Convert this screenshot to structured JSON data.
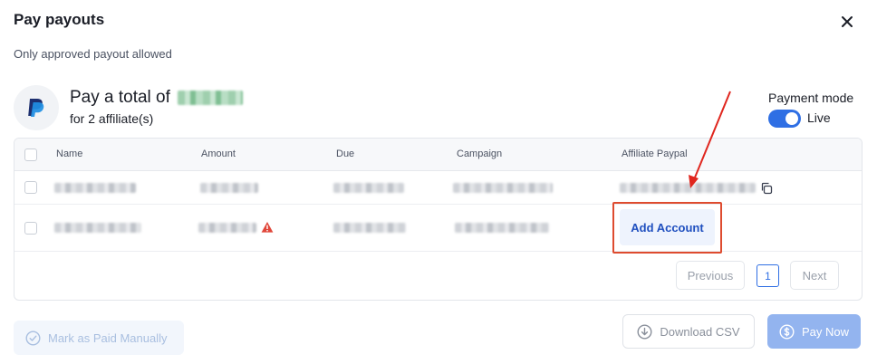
{
  "modal": {
    "title": "Pay payouts",
    "subtitle": "Only approved payout allowed"
  },
  "summary": {
    "total_prefix": "Pay a total of",
    "affiliate_count": "for 2 affiliate(s)"
  },
  "payment_mode": {
    "label": "Payment mode",
    "value": "Live",
    "enabled": true
  },
  "table": {
    "columns": [
      "Name",
      "Amount",
      "Due",
      "Campaign",
      "Affiliate Paypal"
    ],
    "add_account_label": "Add Account"
  },
  "pagination": {
    "previous_label": "Previous",
    "current_page": "1",
    "next_label": "Next"
  },
  "actions": {
    "mark_paid_label": "Mark as Paid Manually",
    "download_csv_label": "Download CSV",
    "pay_now_label": "Pay Now"
  },
  "colors": {
    "accent": "#2f6fe4",
    "highlight": "#de4b2f",
    "warning": "#e0463a"
  },
  "icons": [
    "close-icon",
    "paypal-logo-icon",
    "copy-icon",
    "warning-icon",
    "check-circle-icon",
    "download-icon",
    "dollar-circle-icon",
    "annotation-arrow"
  ]
}
